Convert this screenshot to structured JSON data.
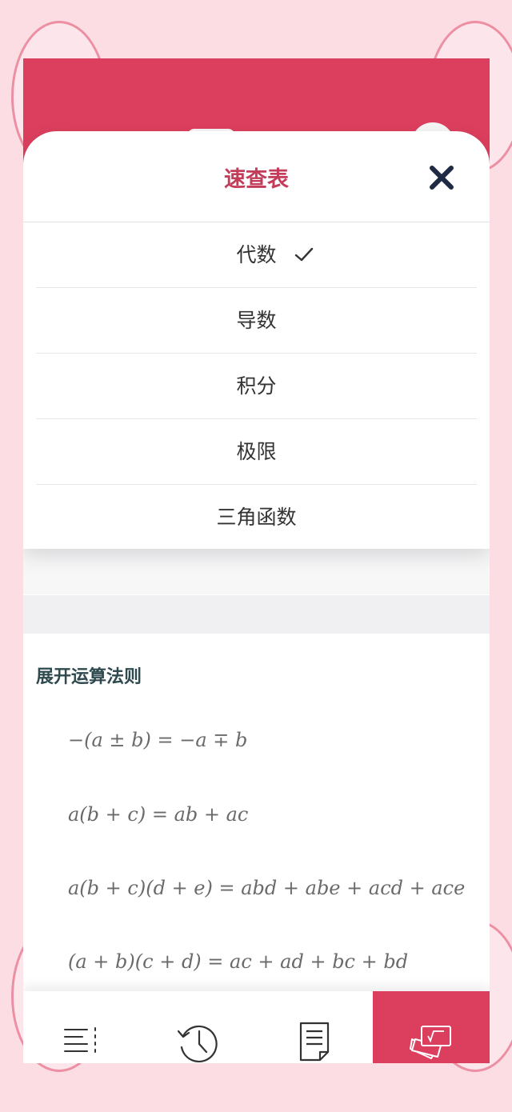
{
  "sheet": {
    "title": "速查表",
    "close_icon": "close-icon",
    "items": [
      {
        "label": "代数",
        "selected": true
      },
      {
        "label": "导数",
        "selected": false
      },
      {
        "label": "积分",
        "selected": false
      },
      {
        "label": "极限",
        "selected": false
      },
      {
        "label": "三角函数",
        "selected": false
      }
    ]
  },
  "section": {
    "title": "展开运算法则",
    "formulas": [
      "−(a ± b) = −a ∓ b",
      "a(b + c) = ab + ac",
      "a(b + c)(d + e) = abd + abe + acd + ace",
      "(a + b)(c + d) = ac + ad + bc + bd"
    ]
  },
  "tabbar": {
    "tabs": [
      {
        "icon": "menu-list-icon",
        "active": false
      },
      {
        "icon": "history-icon",
        "active": false
      },
      {
        "icon": "document-icon",
        "active": false
      },
      {
        "icon": "formula-cards-icon",
        "active": true
      }
    ]
  },
  "colors": {
    "accent": "#db3f5d",
    "title_pink": "#c33d5b",
    "background": "#fbdde3",
    "section_title": "#2e4a4e",
    "close_icon": "#1f2a44"
  }
}
